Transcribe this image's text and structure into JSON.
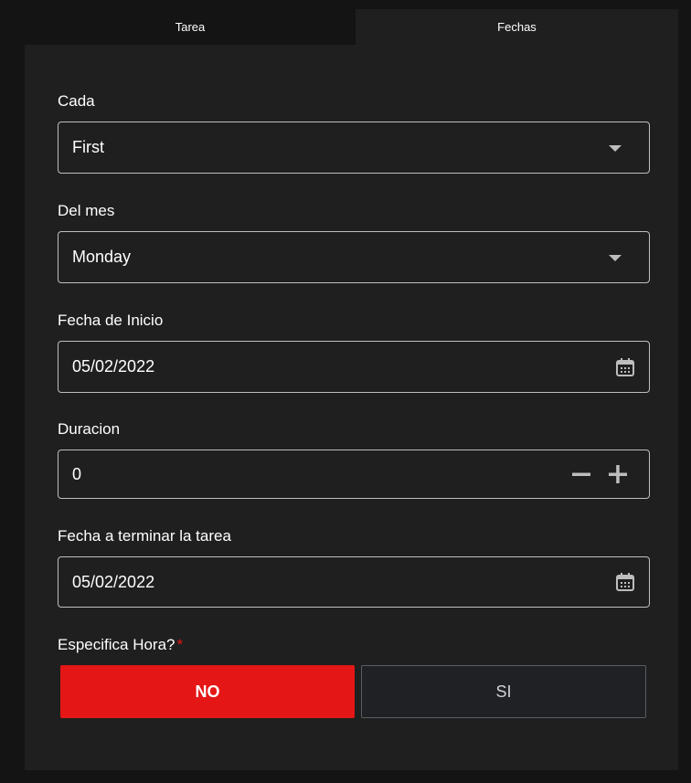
{
  "tabs": [
    {
      "label": "Tarea",
      "active": false
    },
    {
      "label": "Fechas",
      "active": true
    }
  ],
  "form": {
    "cada": {
      "label": "Cada",
      "value": "First"
    },
    "del_mes": {
      "label": "Del mes",
      "value": "Monday"
    },
    "fecha_inicio": {
      "label": "Fecha de Inicio",
      "value": "05/02/2022"
    },
    "duracion": {
      "label": "Duracion",
      "value": "0"
    },
    "fecha_terminar": {
      "label": "Fecha a terminar la tarea",
      "value": "05/02/2022"
    },
    "especifica_hora": {
      "label": "Especifica Hora?",
      "required_mark": "*",
      "options": {
        "no": "NO",
        "si": "SI"
      },
      "selected": "NO"
    }
  },
  "colors": {
    "accent": "#e51616",
    "panel": "#1f1f1f",
    "background": "#141414",
    "border": "#bfbfbf"
  },
  "icons": {
    "select_caret": "caret-down-icon",
    "date": "calendar-icon",
    "decrement": "minus-icon",
    "increment": "plus-icon"
  }
}
